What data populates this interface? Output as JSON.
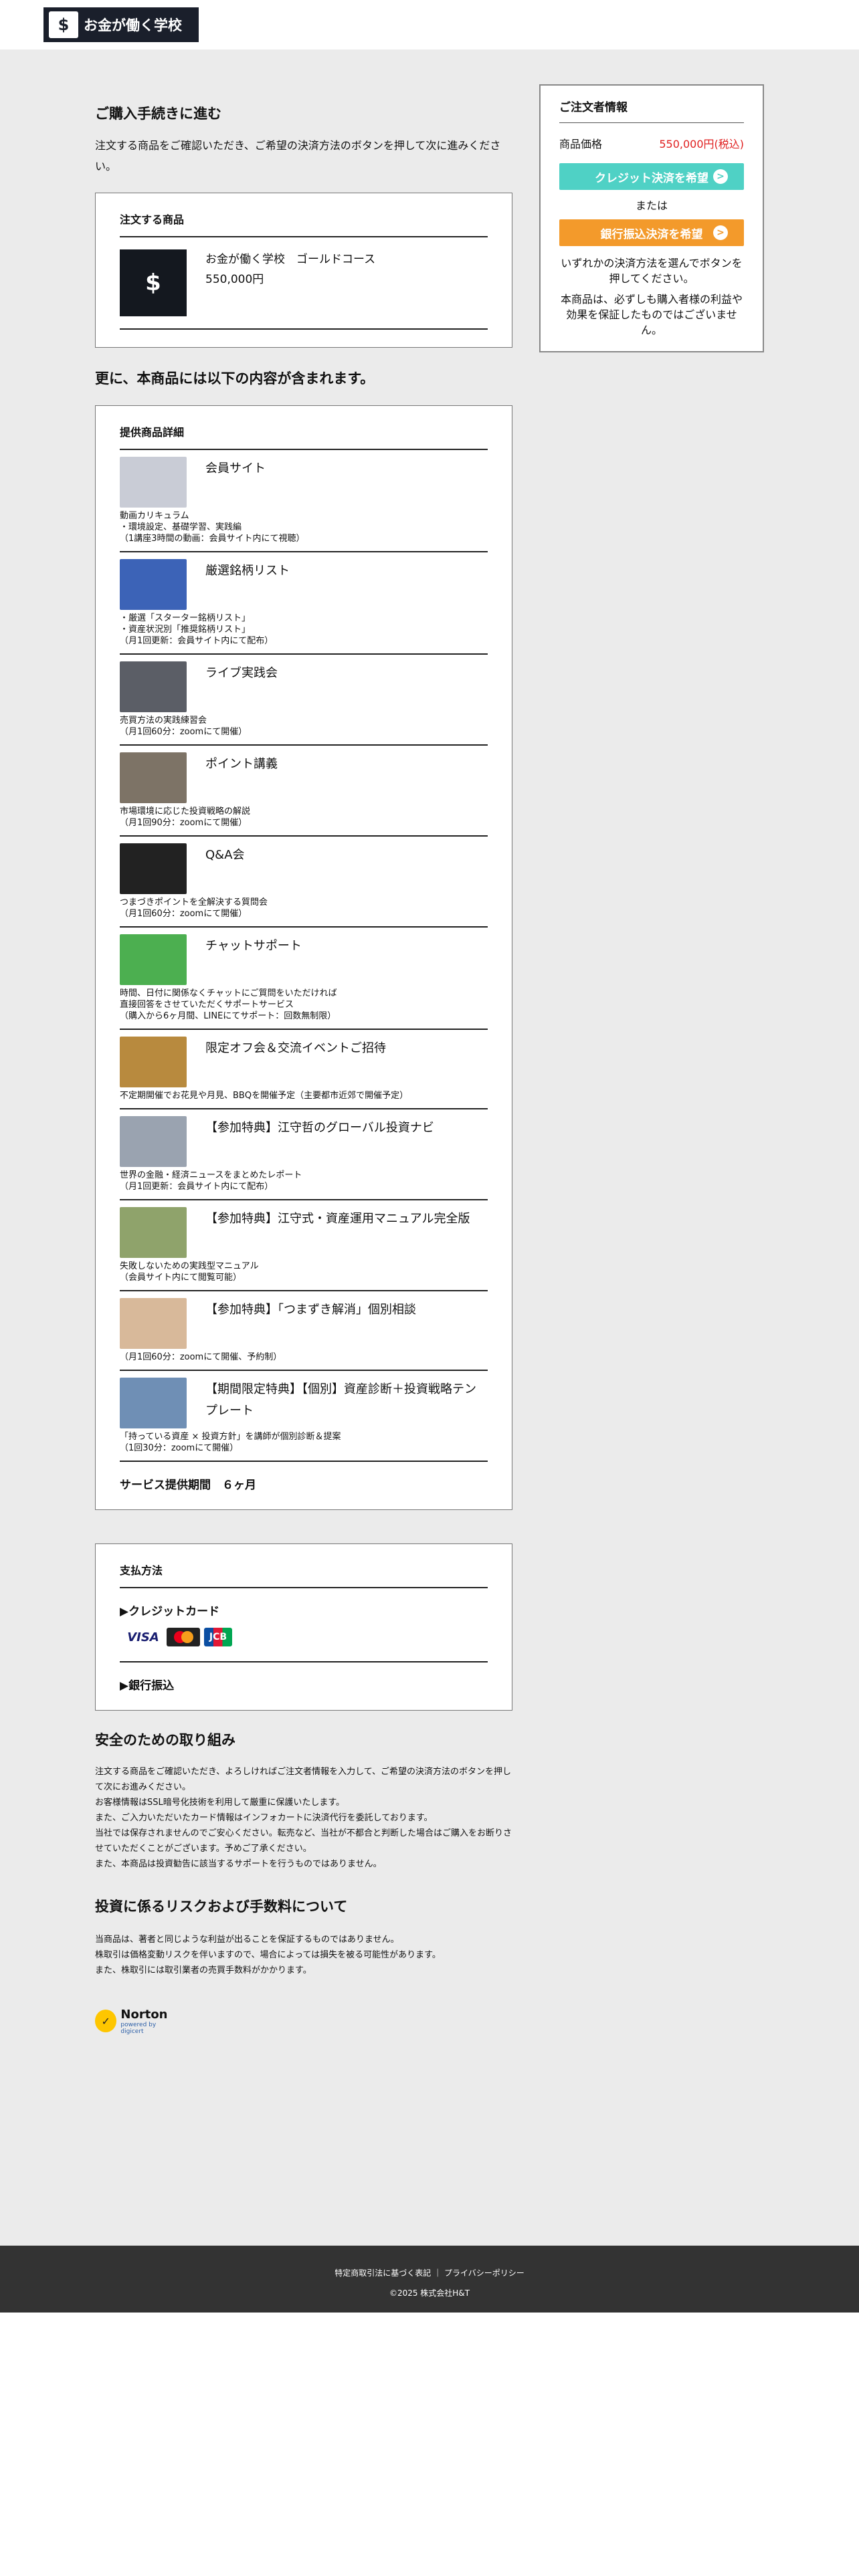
{
  "header": {
    "logo_text": "お金が働く学校",
    "logo_icon": "graduation-cap-dollar-icon"
  },
  "checkout": {
    "heading": "ご購入手続きに進む",
    "lead": "注文する商品をご確認いただき、ご希望の決済方法のボタンを押して次に進みください。",
    "order_box_title": "注文する商品",
    "product_name": "お金が働く学校　ゴールドコース",
    "product_price": "550,000円"
  },
  "includes": {
    "heading": "更に、本商品には以下の内容が含まれます。",
    "box_title": "提供商品詳細",
    "items": [
      {
        "title": "会員サイト",
        "desc": "動画カリキュラム\n・環境設定、基礎学習、実践編\n（1講座3時間の動画：会員サイト内にて視聴）",
        "color": "#c9ccd6"
      },
      {
        "title": "厳選銘柄リスト",
        "desc": "・厳選「スターター銘柄リスト」\n・資産状況別「推奨銘柄リスト」\n（月1回更新：会員サイト内にて配布）",
        "color": "#3c63b7"
      },
      {
        "title": "ライブ実践会",
        "desc": "売買方法の実践練習会\n（月1回60分：zoomにて開催）",
        "color": "#5b5e66"
      },
      {
        "title": "ポイント講義",
        "desc": "市場環境に応じた投資戦略の解説\n（月1回90分：zoomにて開催）",
        "color": "#7d7366"
      },
      {
        "title": "Q&A会",
        "desc": "つまづきポイントを全解決する質問会\n（月1回60分：zoomにて開催）",
        "color": "#222222"
      },
      {
        "title": "チャットサポート",
        "desc": "時間、日付に関係なくチャットにご質問をいただければ\n直接回答をさせていただくサポートサービス\n（購入から6ヶ月間、LINEにてサポート：回数無制限）",
        "color": "#4caf50"
      },
      {
        "title": "限定オフ会＆交流イベントご招待",
        "desc": "不定期開催でお花見や月見、BBQを開催予定（主要都市近郊で開催予定）",
        "color": "#b88a3e"
      },
      {
        "title": "【参加特典】江守哲のグローバル投資ナビ",
        "desc": "世界の金融・経済ニュースをまとめたレポート\n（月1回更新：会員サイト内にて配布）",
        "color": "#9aa3b0"
      },
      {
        "title": "【参加特典】江守式・資産運用マニュアル完全版",
        "desc": "失敗しないための実践型マニュアル\n（会員サイト内にて閲覧可能）",
        "color": "#8fa36b"
      },
      {
        "title": "【参加特典】「つまずき解消」個別相談",
        "desc": "（月1回60分：zoomにて開催、予約制）",
        "color": "#d8b99a"
      },
      {
        "title": "【期間限定特典】【個別】資産診断＋投資戦略テンプレート",
        "desc": "「持っている資産 × 投資方針」を講師が個別診断＆提案\n（1回30分：zoomにて開催）",
        "color": "#6f8fb5"
      }
    ],
    "period": "サービス提供期間　６ヶ月"
  },
  "payment": {
    "title": "支払方法",
    "credit": "▶クレジットカード",
    "bank": "▶銀行振込",
    "cards": [
      "VISA",
      "MC",
      "JCB"
    ]
  },
  "security": {
    "heading": "安全のための取り組み",
    "text": "注文する商品をご確認いただき、よろしければご注文者情報を入力して、ご希望の決済方法のボタンを押して次にお進みください。\nお客様情報はSSL暗号化技術を利用して厳重に保護いたします。\nまた、ご入力いただいたカード情報はインフォカートに決済代行を委託しております。\n当社では保存されませんのでご安心ください。転売など、当社が不都合と判断した場合はご購入をお断りさせていただくことがございます。予めご了承ください。\nまた、本商品は投資勧告に該当するサポートを行うものではありません。"
  },
  "risk": {
    "heading": "投資に係るリスクおよび手数料について",
    "text": "当商品は、著者と同じような利益が出ることを保証するものではありません。\n株取引は価格変動リスクを伴いますので、場合によっては損失を被る可能性があります。\nまた、株取引には取引業者の売買手数料がかかります。"
  },
  "norton": {
    "label": "Norton",
    "sub": "powered by digicert"
  },
  "sidebar": {
    "title": "ご注文者情報",
    "price_label": "商品価格",
    "price_value": "550,000円(税込)",
    "credit_button": "クレジット決済を希望",
    "or": "または",
    "bank_button": "銀行振込決済を希望",
    "note1": "いずれかの決済方法を選んでボタンを押してください。",
    "note2": "本商品は、必ずしも購入者様の利益や効果を保証したものではございません。",
    "colors": {
      "credit": "#4fd1c5",
      "bank": "#f39a2b",
      "price": "#e02020"
    }
  },
  "footer": {
    "link1": "特定商取引法に基づく表記",
    "sep": "｜",
    "link2": "プライバシーポリシー",
    "copyright": "©2025 株式会社H&T"
  }
}
